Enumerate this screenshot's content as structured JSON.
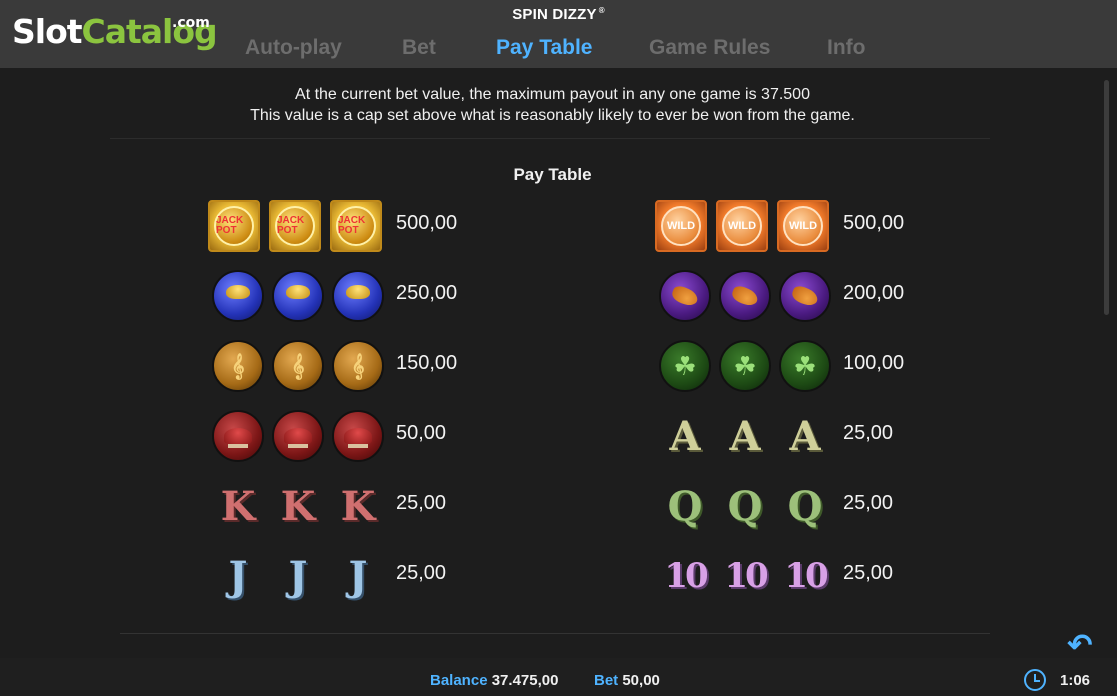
{
  "brand": {
    "logo_slot": "Slot",
    "logo_catalog": "Catalog",
    "logo_dotcom": ".com"
  },
  "game": {
    "title": "SPIN DIZZY",
    "title_mark": "®"
  },
  "tabs": [
    {
      "label": "Auto-play",
      "active": false
    },
    {
      "label": "Bet",
      "active": false
    },
    {
      "label": "Pay Table",
      "active": true
    },
    {
      "label": "Game Rules",
      "active": false
    },
    {
      "label": "Info",
      "active": false
    }
  ],
  "info": {
    "line1": "At the current bet value, the maximum payout in any one game is 37.500",
    "line2": "This value is a cap set above what is reasonably likely to ever be won from the game."
  },
  "pay_table": {
    "title": "Pay Table",
    "left": [
      {
        "symbol": "jackpot-icon",
        "text": "JACK POT",
        "value": "500,00"
      },
      {
        "symbol": "pot-of-gold-icon",
        "value": "250,00"
      },
      {
        "symbol": "harp-icon",
        "value": "150,00"
      },
      {
        "symbol": "mushroom-icon",
        "value": "50,00"
      },
      {
        "symbol": "letter-k-icon",
        "text": "K",
        "value": "25,00"
      },
      {
        "symbol": "letter-j-icon",
        "text": "J",
        "value": "25,00"
      }
    ],
    "right": [
      {
        "symbol": "wild-icon",
        "text": "WILD",
        "value": "500,00"
      },
      {
        "symbol": "hat-icon",
        "value": "200,00"
      },
      {
        "symbol": "clover-icon",
        "text": "☘",
        "value": "100,00"
      },
      {
        "symbol": "letter-a-icon",
        "text": "A",
        "value": "25,00"
      },
      {
        "symbol": "letter-q-icon",
        "text": "Q",
        "value": "25,00"
      },
      {
        "symbol": "letter-10-icon",
        "text": "10",
        "value": "25,00"
      }
    ]
  },
  "footer": {
    "balance_label": "Balance",
    "balance_value": "37.475,00",
    "bet_label": "Bet",
    "bet_value": "50,00",
    "time": "1:06",
    "back_icon": "↶"
  },
  "colors": {
    "accent": "#4fb3ff",
    "brand_green": "#8bc43f",
    "header_bg": "#3a3a3a",
    "page_bg": "#1d1d1d"
  }
}
